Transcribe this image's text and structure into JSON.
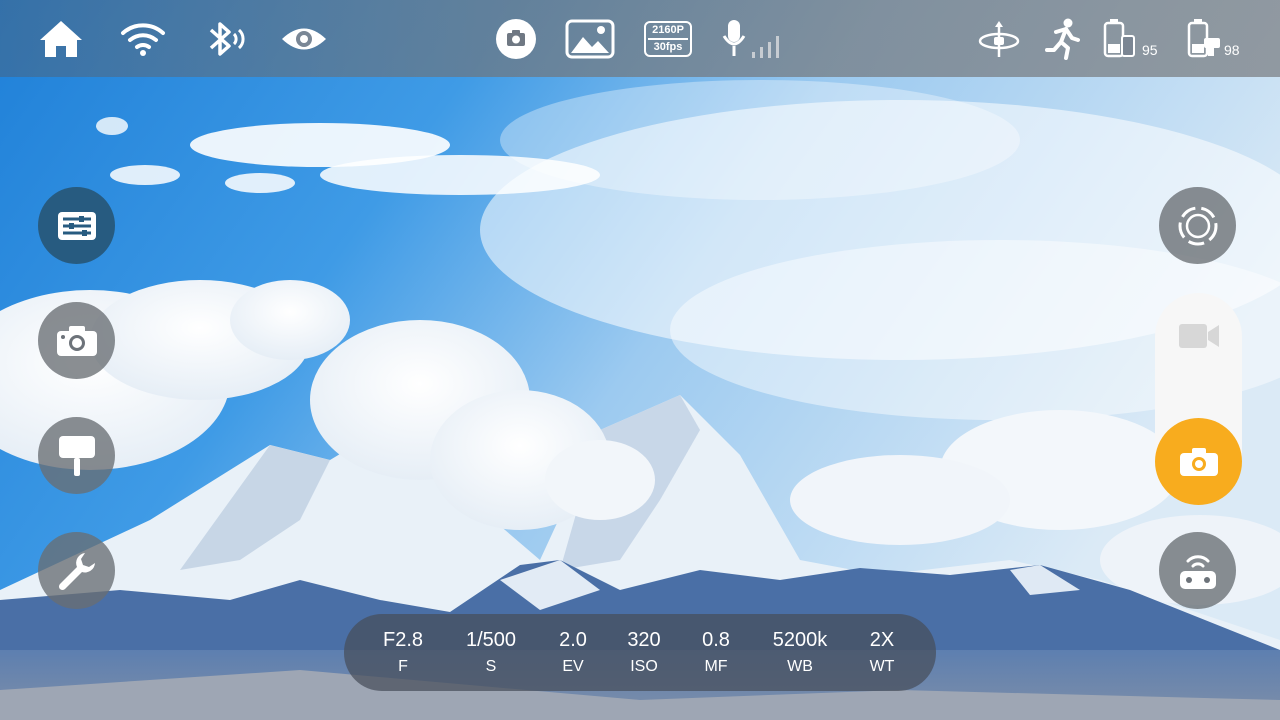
{
  "topbar": {
    "icons": [
      "home-icon",
      "wifi-icon",
      "bluetooth-icon",
      "eye-icon",
      "camera-mode-icon",
      "gallery-icon",
      "resolution-icon",
      "mic-icon",
      "gimbal-icon",
      "motion-icon",
      "phone-battery-icon",
      "gimbal-battery-icon"
    ],
    "resolution": "2160P",
    "fps": "30fps",
    "phone_battery": "95",
    "gimbal_battery": "98"
  },
  "left_buttons": [
    "settings-button",
    "photo-mode-button",
    "selfie-stick-button",
    "tools-button"
  ],
  "right_buttons": [
    "focus-ring-button",
    "video-mode-button",
    "shutter-photo-button",
    "remote-control-button"
  ],
  "params": [
    {
      "value": "F2.8",
      "key": "F"
    },
    {
      "value": "1/500",
      "key": "S"
    },
    {
      "value": "2.0",
      "key": "EV"
    },
    {
      "value": "320",
      "key": "ISO"
    },
    {
      "value": "0.8",
      "key": "MF"
    },
    {
      "value": "5200k",
      "key": "WB"
    },
    {
      "value": "2X",
      "key": "WT"
    }
  ],
  "colors": {
    "accent": "#f8ac1e",
    "settings_button": "#275b80",
    "sky": "#2f8fe0"
  }
}
